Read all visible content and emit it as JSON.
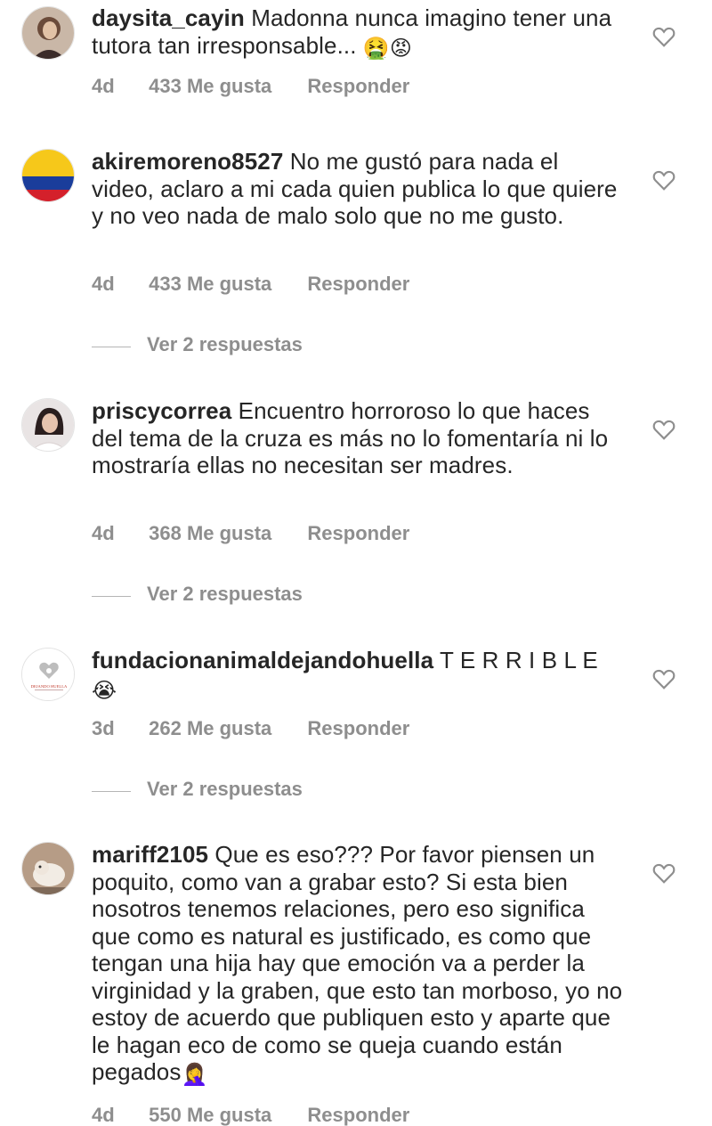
{
  "comments": [
    {
      "username": "daysita_cayin",
      "text": "Madonna nunca imagino tener una tutora tan irresponsable... ",
      "emoji_tail": "🤮😡",
      "time": "4d",
      "likes": "433 Me gusta",
      "reply": "Responder",
      "avatar_icon": "user-photo-avatar"
    },
    {
      "username": "akiremoreno8527",
      "text": "No me gustó para nada el video, aclaro a mi cada quien publica lo que quiere y no veo nada de malo solo que no me gusto.",
      "emoji_tail": "",
      "time": "4d",
      "likes": "433 Me gusta",
      "reply": "Responder",
      "view_replies": "Ver 2 respuestas",
      "avatar_icon": "colombia-flag-avatar"
    },
    {
      "username": "priscycorrea",
      "text": "Encuentro horroroso lo que haces del tema de la cruza  es más no lo fomentaría ni lo mostraría ellas no necesitan ser madres.",
      "emoji_tail": "",
      "time": "4d",
      "likes": "368 Me gusta",
      "reply": "Responder",
      "view_replies": "Ver 2 respuestas",
      "avatar_icon": "user-photo-avatar"
    },
    {
      "username": "fundacionanimaldejandohuella",
      "text": "T E R R I B L E ",
      "emoji_tail": "😭",
      "time": "3d",
      "likes": "262 Me gusta",
      "reply": "Responder",
      "view_replies": "Ver 2 respuestas",
      "avatar_icon": "foundation-logo-avatar",
      "avatar_logo_text": "DEJANDO HUELLA"
    },
    {
      "username": "mariff2105",
      "text": "Que es eso??? Por favor piensen un poquito, como van a grabar esto? Si esta bien nosotros tenemos relaciones, pero eso significa que como es natural es justificado, es como que tengan una hija hay que emoción va a perder la virginidad y la graben, que esto tan morboso, yo no estoy de acuerdo que publiquen esto y aparte que le hagan eco de como se queja cuando están pegados",
      "emoji_tail": "🤦‍♀️",
      "time": "4d",
      "likes": "550 Me gusta",
      "reply": "Responder",
      "avatar_icon": "user-photo-avatar"
    }
  ],
  "icons": {
    "like": "heart-outline-icon"
  },
  "colors": {
    "text": "#262626",
    "meta": "#8e8e8e"
  }
}
